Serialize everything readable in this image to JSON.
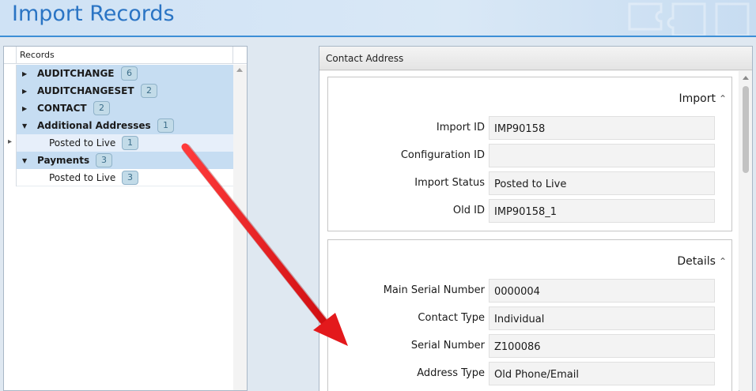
{
  "header": {
    "title": "Import Records"
  },
  "tree": {
    "column_header": "Records",
    "rows": [
      {
        "label": "AUDITCHANGE",
        "count": "6",
        "level": 0,
        "bold": true,
        "expander": "▶",
        "selected": true
      },
      {
        "label": "AUDITCHANGESET",
        "count": "2",
        "level": 0,
        "bold": true,
        "expander": "▶",
        "selected": true
      },
      {
        "label": "CONTACT",
        "count": "2",
        "level": 0,
        "bold": true,
        "expander": "▶",
        "selected": true
      },
      {
        "label": "Additional Addresses",
        "count": "1",
        "level": 0,
        "bold": true,
        "expander": "▼",
        "selected": true
      },
      {
        "label": "Posted to Live",
        "count": "1",
        "level": 1,
        "bold": false,
        "expander": "",
        "selected": "light",
        "gutter_marker": "▸"
      },
      {
        "label": "Payments",
        "count": "3",
        "level": 0,
        "bold": true,
        "expander": "▼",
        "selected": true
      },
      {
        "label": "Posted to Live",
        "count": "3",
        "level": 1,
        "bold": false,
        "expander": "",
        "selected": false
      }
    ]
  },
  "contact": {
    "title": "Contact Address",
    "import_group": {
      "title": "Import",
      "fields": [
        {
          "label": "Import ID",
          "value": "IMP90158"
        },
        {
          "label": "Configuration ID",
          "value": ""
        },
        {
          "label": "Import Status",
          "value": "Posted to Live"
        },
        {
          "label": "Old ID",
          "value": "IMP90158_1"
        }
      ]
    },
    "details_group": {
      "title": "Details",
      "fields": [
        {
          "label": "Main Serial Number",
          "value": "0000004"
        },
        {
          "label": "Contact Type",
          "value": "Individual"
        },
        {
          "label": "Serial Number",
          "value": "Z100086"
        },
        {
          "label": "Address Type",
          "value": "Old Phone/Email"
        }
      ]
    }
  },
  "icons": {
    "collapse": "chevron-up-icon",
    "expand_collapsed": "triangle-right-icon",
    "expand_open": "triangle-down-icon",
    "annotation": "red-arrow"
  },
  "colors": {
    "header_title": "#2a74c4",
    "selection": "#c6ddf2",
    "badge": "#c2dbe8",
    "arrow": "#e3191c"
  }
}
